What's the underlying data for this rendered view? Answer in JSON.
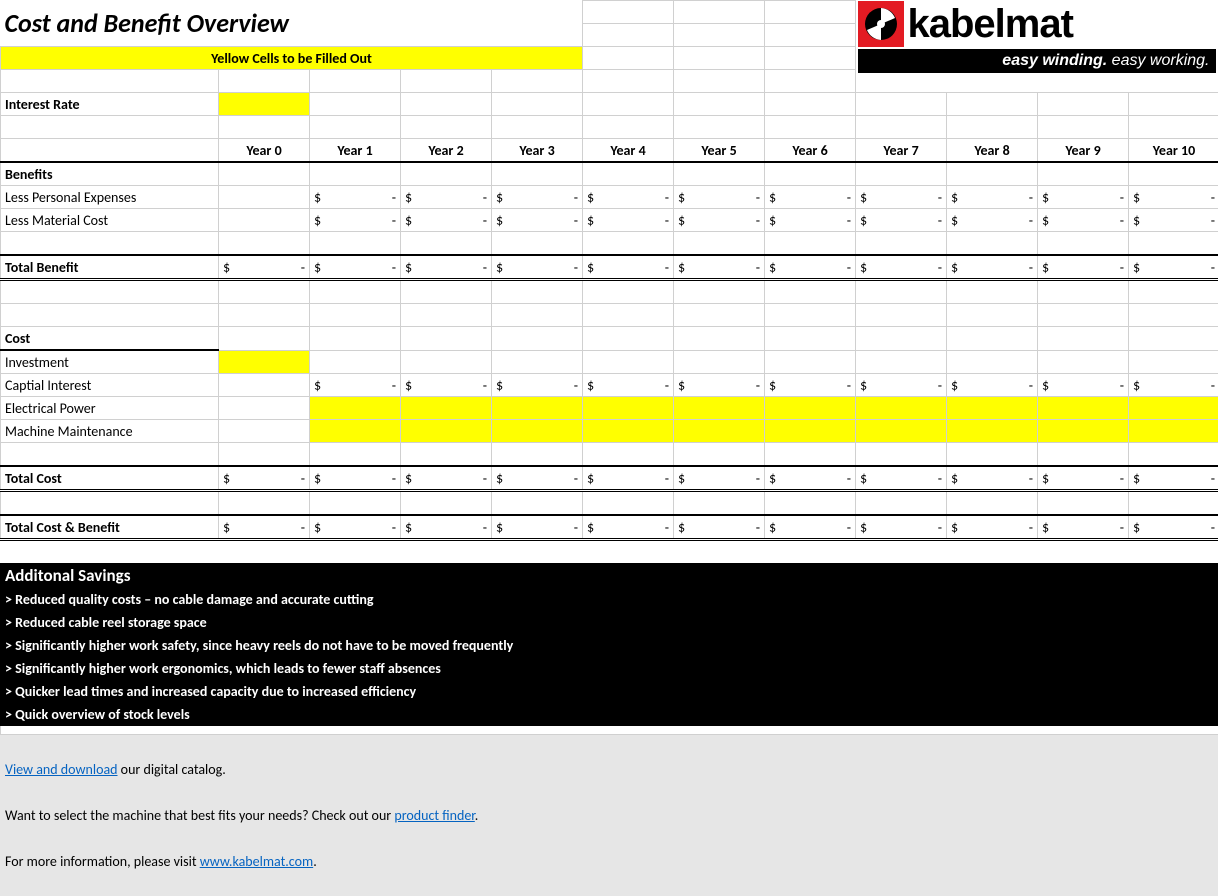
{
  "header": {
    "title": "Cost and Benefit Overview",
    "subtitle": "Yellow Cells to be Filled Out",
    "logo_brand": "kabelmat",
    "logo_tagline_bold": "easy winding.",
    "logo_tagline_light": "easy working."
  },
  "labels": {
    "interest_rate": "Interest Rate",
    "benefits": "Benefits",
    "less_personal": "Less Personal Expenses",
    "less_material": "Less Material Cost",
    "total_benefit": "Total Benefit",
    "cost": "Cost",
    "investment": "Investment",
    "capital_interest": "Captial Interest",
    "electrical_power": "Electrical Power",
    "machine_maintenance": "Machine Maintenance",
    "total_cost": "Total Cost",
    "total_cost_benefit": "Total Cost & Benefit"
  },
  "years": [
    "Year 0",
    "Year 1",
    "Year 2",
    "Year 3",
    "Year 4",
    "Year 5",
    "Year 6",
    "Year 7",
    "Year 8",
    "Year 9",
    "Year 10"
  ],
  "currency_symbol": "$",
  "empty_value": "-",
  "savings": {
    "title": "Additonal Savings",
    "lines": [
      "> Reduced quality costs – no cable damage and accurate cutting",
      "> Reduced cable reel storage space",
      "> Significantly higher work safety, since heavy reels do not have to be moved frequently",
      "> Significantly higher work ergonomics, which leads to fewer staff absences",
      "> Quicker lead times and increased capacity due to increased efficiency",
      "> Quick overview of stock levels"
    ]
  },
  "footer": {
    "line1_link": "View and download",
    "line1_rest": " our digital catalog.",
    "line2_pre": "Want to select the machine that best fits your needs? Check out our ",
    "line2_link": "product finder",
    "line2_post": ".",
    "line3_pre": "For more information, please visit ",
    "line3_link": "www.kabelmat.com",
    "line3_post": "."
  }
}
